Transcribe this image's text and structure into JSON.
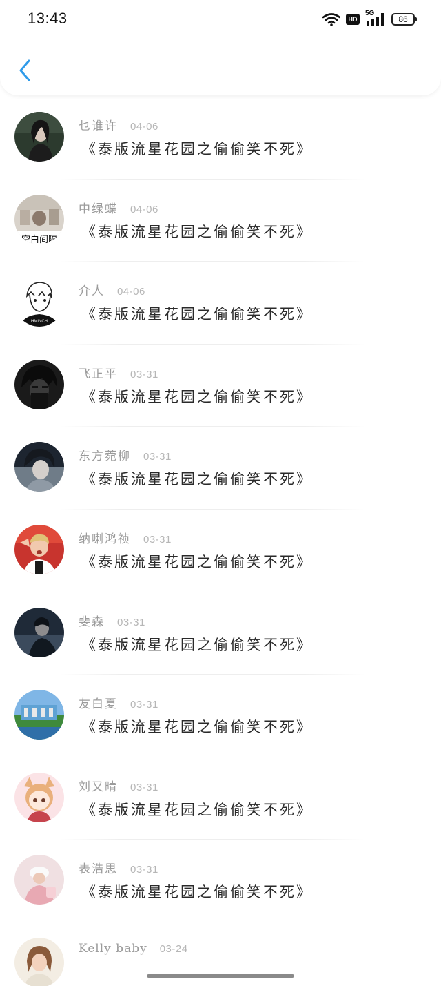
{
  "status_bar": {
    "time": "13:43",
    "network": "5G",
    "hd_label": "HD",
    "battery": "86"
  },
  "header": {
    "back_icon": "chevron-left-icon",
    "accent_color": "#2f9bea"
  },
  "comments": [
    {
      "user": "乜谁许",
      "date": "04-06",
      "text": "《泰版流星花园之偷偷笑不死》"
    },
    {
      "user": "中绿蝶",
      "date": "04-06",
      "text": "《泰版流星花园之偷偷笑不死》"
    },
    {
      "user": "介人",
      "date": "04-06",
      "text": "《泰版流星花园之偷偷笑不死》"
    },
    {
      "user": "飞正平",
      "date": "03-31",
      "text": "《泰版流星花园之偷偷笑不死》"
    },
    {
      "user": "东方菀柳",
      "date": "03-31",
      "text": "《泰版流星花园之偷偷笑不死》"
    },
    {
      "user": "纳喇鸿祯",
      "date": "03-31",
      "text": "《泰版流星花园之偷偷笑不死》"
    },
    {
      "user": "斐森",
      "date": "03-31",
      "text": "《泰版流星花园之偷偷笑不死》"
    },
    {
      "user": "友白夏",
      "date": "03-31",
      "text": "《泰版流星花园之偷偷笑不死》"
    },
    {
      "user": "刘又晴",
      "date": "03-31",
      "text": "《泰版流星花园之偷偷笑不死》"
    },
    {
      "user": "表浩思",
      "date": "03-31",
      "text": "《泰版流星花园之偷偷笑不死》"
    },
    {
      "user": "Kelly baby",
      "date": "03-24",
      "text": ""
    }
  ],
  "avatar_overlay_text": "空白间隔"
}
